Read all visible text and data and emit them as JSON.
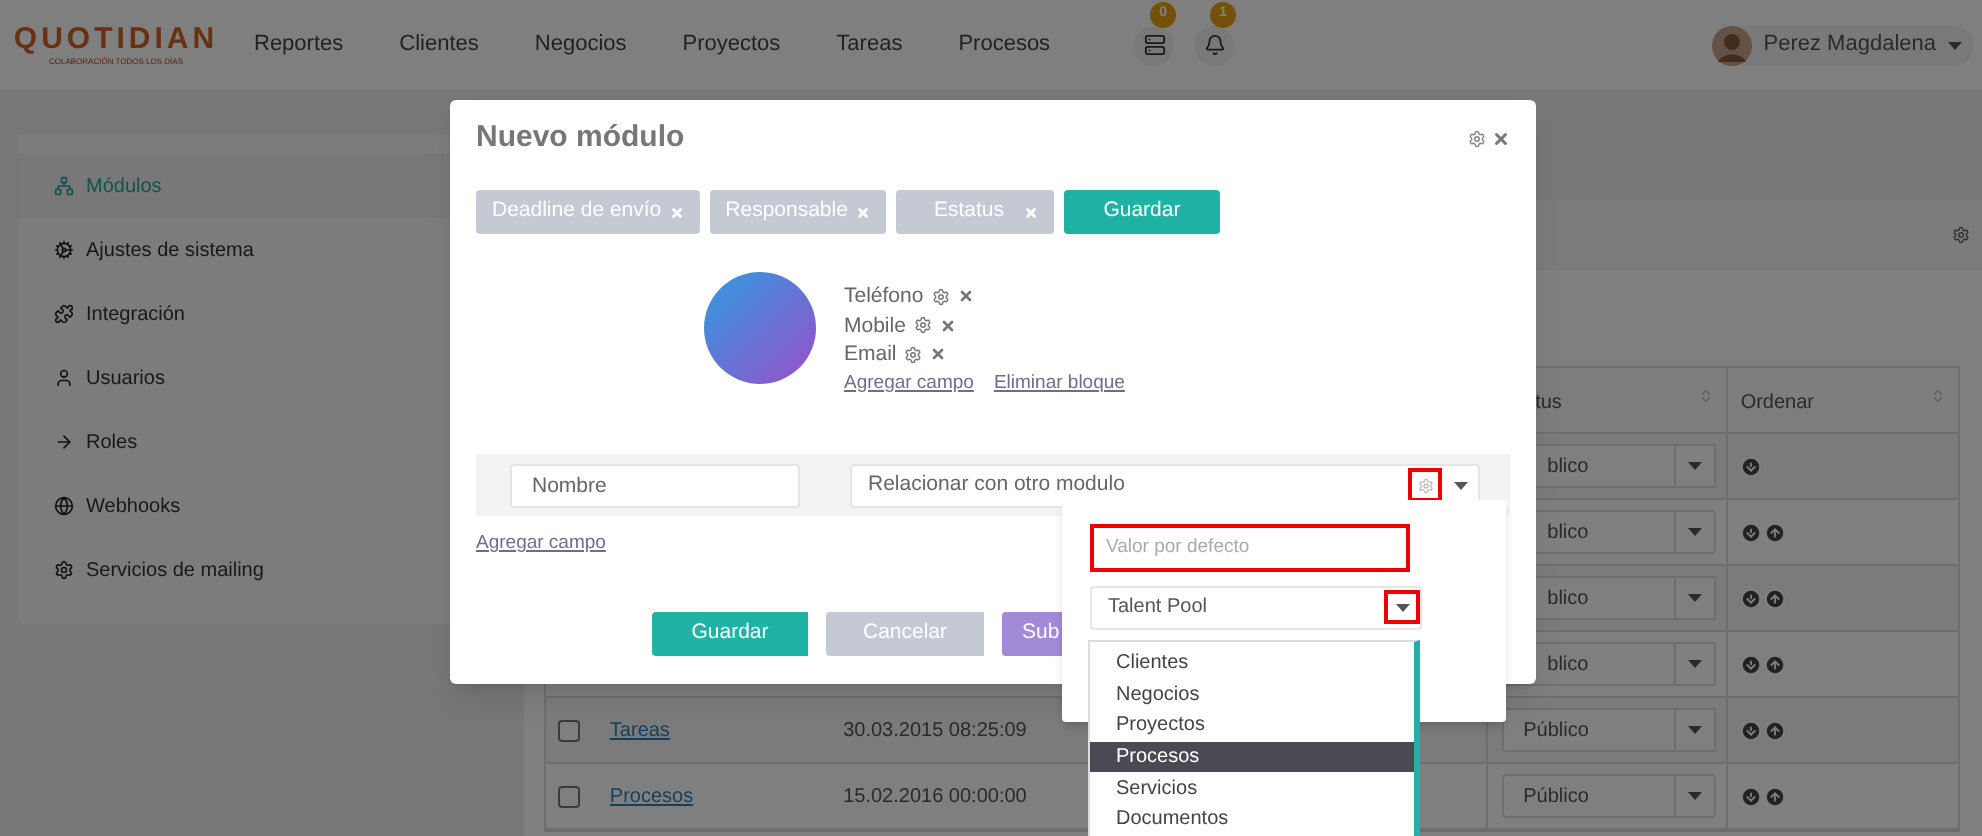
{
  "header": {
    "logo": "QUOTIDIAN",
    "tagline": "COLABORACIÓN TODOS LOS DÍAS",
    "nav": [
      "Reportes",
      "Clientes",
      "Negocios",
      "Proyectos",
      "Tareas",
      "Procesos"
    ],
    "tasks_badge": "0",
    "notifications_badge": "1",
    "user": "Perez Magdalena"
  },
  "sidebar": {
    "items": [
      {
        "label": "Módulos",
        "selected": true
      },
      {
        "label": "Ajustes de sistema",
        "selected": false
      },
      {
        "label": "Integración",
        "selected": false
      },
      {
        "label": "Usuarios",
        "selected": false
      },
      {
        "label": "Roles",
        "selected": false
      },
      {
        "label": "Webhooks",
        "selected": false
      },
      {
        "label": "Servicios de mailing",
        "selected": false
      }
    ]
  },
  "table": {
    "columns": [
      "tus",
      "Ordenar"
    ],
    "rows": [
      {
        "status": "blico",
        "move_up": false
      },
      {
        "status": "blico",
        "move_up": true
      },
      {
        "status": "blico",
        "move_up": true
      },
      {
        "status": "blico",
        "move_up": true
      },
      {
        "checked": false,
        "name": "Tareas",
        "date": "30.03.2015 08:25:09",
        "status": "Público",
        "move_up": true
      },
      {
        "checked": false,
        "name": "Procesos",
        "date": "15.02.2016 00:00:00",
        "status": "Público",
        "move_up": true
      }
    ]
  },
  "modal": {
    "title": "Nuevo módulo",
    "chips": [
      "Deadline de envío",
      "Responsable",
      "Estatus"
    ],
    "save": "Guardar",
    "block": {
      "fields": [
        "Teléfono",
        "Mobile",
        "Email"
      ],
      "links": [
        "Agregar campo",
        "Eliminar bloque"
      ]
    },
    "name_placeholder": "Nombre",
    "relation_placeholder": "Relacionar con otro modulo",
    "add_field": "Agregar campo",
    "buttons": [
      {
        "label": "Guardar",
        "kind": "primary"
      },
      {
        "label": "Cancelar",
        "kind": "secondary"
      },
      {
        "label": "Sub",
        "kind": "submit"
      }
    ]
  },
  "popup": {
    "default_placeholder": "Valor por defecto",
    "select_value": "Talent Pool",
    "options": [
      {
        "label": "Clientes",
        "selected": false
      },
      {
        "label": "Negocios",
        "selected": false
      },
      {
        "label": "Proyectos",
        "selected": false
      },
      {
        "label": "Procesos",
        "selected": true
      },
      {
        "label": "Servicios",
        "selected": false
      },
      {
        "label": "Documentos",
        "selected": false
      }
    ]
  }
}
